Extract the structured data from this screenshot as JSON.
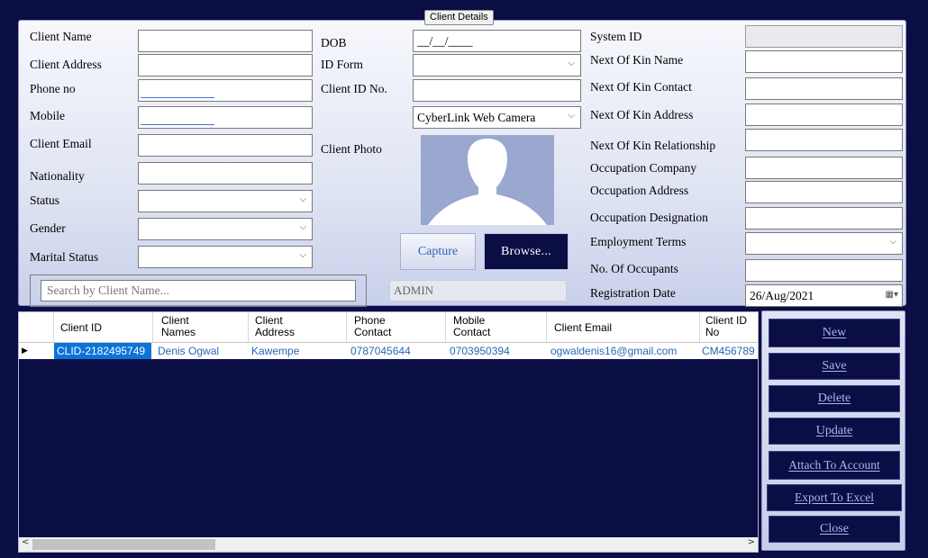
{
  "group_title": "Client Details",
  "labels": {
    "client_name": "Client Name",
    "client_address": "Client Address",
    "phone_no": "Phone no",
    "mobile": "Mobile",
    "client_email": "Client Email",
    "nationality": "Nationality",
    "status": "Status",
    "gender": "Gender",
    "marital_status": "Marital Status",
    "dob": "DOB",
    "id_form": "ID Form",
    "client_id_no": "Client ID No.",
    "client_photo": "Client Photo",
    "system_id": "System ID",
    "next_of_kin_name": "Next Of Kin Name",
    "next_of_kin_contact": "Next Of Kin Contact",
    "next_of_kin_address": "Next Of Kin Address",
    "next_of_kin_relationship": "Next Of Kin Relationship",
    "occupation_company": "Occupation Company",
    "occupation_address": "Occupation Address",
    "occupation_designation": "Occupation Designation",
    "employment_terms": "Employment Terms",
    "no_of_occupants": "No. Of Occupants",
    "registration_date": "Registration Date"
  },
  "values": {
    "dob": "__/__/____",
    "camera": "CyberLink Web Camera",
    "admin": "ADMIN",
    "registration_date": "26/Aug/2021"
  },
  "search": {
    "placeholder": "Search by Client Name..."
  },
  "buttons": {
    "capture": "Capture",
    "browse": "Browse...",
    "new": "New",
    "save": "Save",
    "delete": "Delete",
    "update": "Update",
    "attach": "Attach To Account",
    "export": "Export To Excel",
    "close": "Close"
  },
  "grid": {
    "headers": [
      {
        "l1": "Client ID",
        "l2": ""
      },
      {
        "l1": "Client",
        "l2": "Names"
      },
      {
        "l1": "Client",
        "l2": "Address"
      },
      {
        "l1": "Phone",
        "l2": "Contact"
      },
      {
        "l1": "Mobile",
        "l2": "Contact"
      },
      {
        "l1": "Client Email",
        "l2": ""
      },
      {
        "l1": "Client ID",
        "l2": "No"
      }
    ],
    "rows": [
      [
        "CLID-2182495749",
        "Denis Ogwal",
        "Kawempe",
        "0787045644",
        "0703950394",
        "ogwaldenis16@gmail.com",
        "CM456789"
      ]
    ]
  },
  "colors": {
    "background": "#0b0d45",
    "accent": "#2a67b5",
    "selection": "#0a74d9"
  }
}
